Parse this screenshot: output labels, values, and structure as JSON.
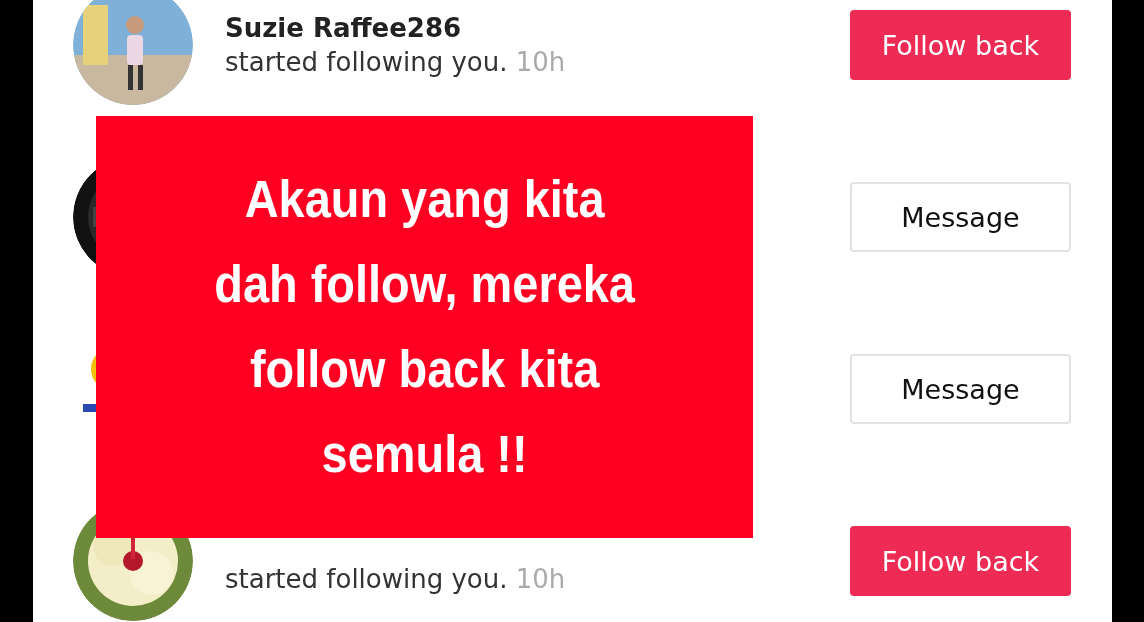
{
  "notifications": [
    {
      "kind": "follow",
      "name": "Suzie Raffee286",
      "text": "started following you.",
      "time": "10h",
      "button": "Follow back"
    },
    {
      "kind": "message",
      "button": "Message"
    },
    {
      "kind": "message",
      "button": "Message"
    },
    {
      "kind": "follow",
      "text": "started following you.",
      "time": "10h",
      "button": "Follow back"
    }
  ],
  "overlay": {
    "lines": [
      "Akaun yang kita",
      "dah follow, mereka",
      "follow back kita",
      "semula !!"
    ]
  }
}
